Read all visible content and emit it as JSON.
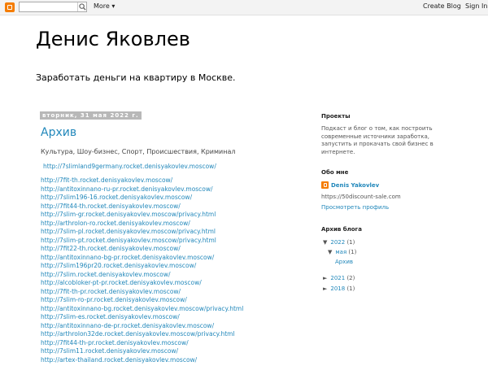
{
  "navbar": {
    "more_label": "More ▾",
    "create_blog": "Create Blog",
    "sign_in": "Sign In",
    "search_placeholder": ""
  },
  "header": {
    "title": "Денис Яковлев",
    "description": "Заработать деньги на квартиру в Москве."
  },
  "post": {
    "date": "вторник, 31 мая 2022 г.",
    "title": "Архив",
    "labels": "Культура, Шоу-бизнес, Спорт, Происшествия, Криминал",
    "first_link": "http://7slimland9germany.rocket.denisyakovlev.moscow/",
    "links": [
      "http://7fit-th.rocket.denisyakovlev.moscow/",
      "http://antitoxinnano-ru-pr.rocket.denisyakovlev.moscow/",
      "http://7slim196-16.rocket.denisyakovlev.moscow/",
      "http://7fit44-th.rocket.denisyakovlev.moscow/",
      "http://7slim-gr.rocket.denisyakovlev.moscow/privacy.html",
      "http://arthrolon-ro.rocket.denisyakovlev.moscow/",
      "http://7slim-pl.rocket.denisyakovlev.moscow/privacy.html",
      "http://7slim-pt.rocket.denisyakovlev.moscow/privacy.html",
      "http://7fit22-th.rocket.denisyakovlev.moscow/",
      "http://antitoxinnano-bg-pr.rocket.denisyakovlev.moscow/",
      "http://7slim196pr20.rocket.denisyakovlev.moscow/",
      "http://7slim.rocket.denisyakovlev.moscow/",
      "http://alcobloker-pt-pr.rocket.denisyakovlev.moscow/",
      "http://7fit-th-pr.rocket.denisyakovlev.moscow/",
      "http://7slim-ro-pr.rocket.denisyakovlev.moscow/",
      "http://antitoxinnano-bg.rocket.denisyakovlev.moscow/privacy.html",
      "http://7slim-es.rocket.denisyakovlev.moscow/",
      "http://antitoxinnano-de-pr.rocket.denisyakovlev.moscow/",
      "http://arthrolon32de.rocket.denisyakovlev.moscow/privacy.html",
      "http://7fit44-th-pr.rocket.denisyakovlev.moscow/",
      "http://7slim11.rocket.denisyakovlev.moscow/",
      "http://artex-thailand.rocket.denisyakovlev.moscow/"
    ]
  },
  "sidebar": {
    "projects_heading": "Проекты",
    "projects_text": "Подкаст и блог о том, как построить современные источники заработка, запустить и прокачать свой бизнес в интернете.",
    "about_heading": "Обо мне",
    "profile_name": "Denis Yakovlev",
    "profile_url": "https://50discount-sale.com",
    "view_profile": "Просмотреть профиль",
    "archive_heading": "Архив блога",
    "archive": {
      "y2022": {
        "year": "2022",
        "count": "(1)"
      },
      "may": {
        "month": "мая",
        "count": "(1)"
      },
      "post": "Архив",
      "y2021": {
        "year": "2021",
        "count": "(2)"
      },
      "y2018": {
        "year": "2018",
        "count": "(1)"
      }
    }
  },
  "colors": {
    "link": "#2288bb",
    "blogger_orange": "#f57d00",
    "date_header_bg": "#b8b8b8"
  }
}
